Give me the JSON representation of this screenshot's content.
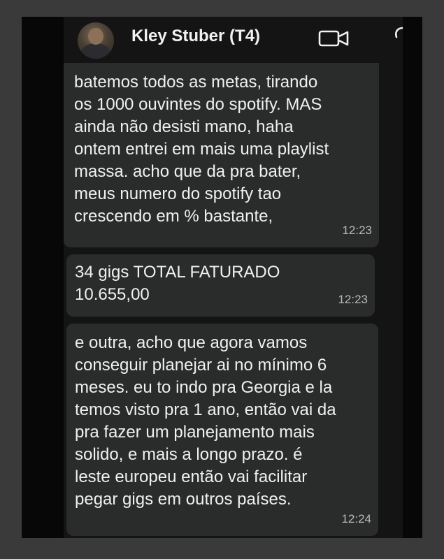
{
  "header": {
    "contact_name": "Kley Stuber (T4)",
    "avatar": "contact-avatar",
    "icons": [
      "video-call-icon",
      "voice-call-icon"
    ]
  },
  "messages": [
    {
      "lines": [
        "batemos todos as metas, tirando",
        "os 1000 ouvintes do spotify. MAS",
        "ainda não desisti mano, haha",
        "ontem entrei em mais uma playlist",
        "massa. acho que da pra bater,",
        "meus numero do spotify tao",
        "crescendo em % bastante,"
      ],
      "time": "12:23"
    },
    {
      "lines": [
        "34 gigs TOTAL FATURADO",
        "10.655,00"
      ],
      "time": "12:23"
    },
    {
      "lines": [
        "e outra, acho que agora vamos",
        "conseguir planejar ai no mínimo 6",
        "meses. eu to indo pra Georgia e la",
        "temos visto pra 1 ano, então vai da",
        "pra fazer um planejamento mais",
        "solido, e mais a longo prazo. é",
        "leste europeu então vai facilitar",
        "pegar gigs em outros países."
      ],
      "time": "12:24"
    }
  ],
  "colors": {
    "bubble": "#2a2b2b",
    "chat_background": "#141414",
    "text": "#f0f0f0",
    "timestamp": "#b8b8b8"
  }
}
